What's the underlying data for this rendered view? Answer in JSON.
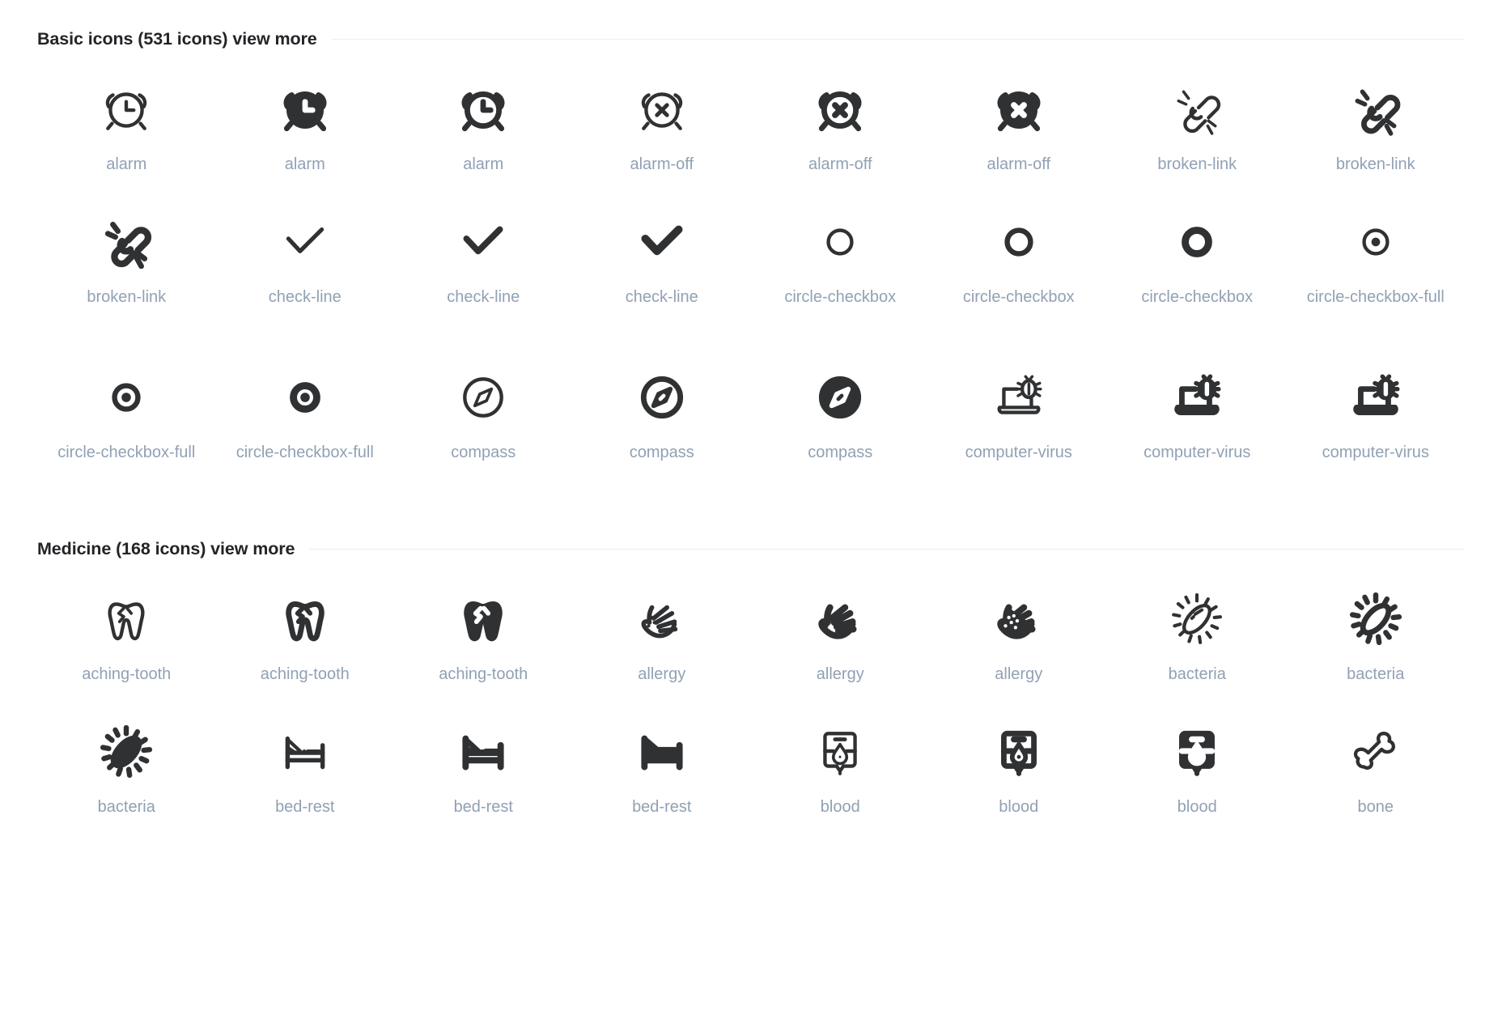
{
  "theme": {
    "background": "#ffffff",
    "icon_color": "#2f3133",
    "label_color": "#91a1b4",
    "title_color": "#222427",
    "rule_color": "#eceef1"
  },
  "sections": [
    {
      "id": "basic-icons",
      "title": "Basic icons (531 icons) view more",
      "name": "Basic icons",
      "count": "531 icons",
      "view_more": "view more",
      "icons": [
        {
          "label": "alarm",
          "glyph": "alarm",
          "style": "line"
        },
        {
          "label": "alarm",
          "glyph": "alarm",
          "style": "solid"
        },
        {
          "label": "alarm",
          "glyph": "alarm",
          "style": "bold"
        },
        {
          "label": "alarm-off",
          "glyph": "alarm-off",
          "style": "line"
        },
        {
          "label": "alarm-off",
          "glyph": "alarm-off",
          "style": "bold"
        },
        {
          "label": "alarm-off",
          "glyph": "alarm-off",
          "style": "solid"
        },
        {
          "label": "broken-link",
          "glyph": "broken-link",
          "style": "line"
        },
        {
          "label": "broken-link",
          "glyph": "broken-link",
          "style": "bold"
        },
        {
          "label": "broken-link",
          "glyph": "broken-link",
          "style": "solid"
        },
        {
          "label": "check-line",
          "glyph": "check-line",
          "style": "line"
        },
        {
          "label": "check-line",
          "glyph": "check-line",
          "style": "bold"
        },
        {
          "label": "check-line",
          "glyph": "check-line",
          "style": "solid"
        },
        {
          "label": "circle-checkbox",
          "glyph": "circle-checkbox",
          "style": "line"
        },
        {
          "label": "circle-checkbox",
          "glyph": "circle-checkbox",
          "style": "bold"
        },
        {
          "label": "circle-checkbox",
          "glyph": "circle-checkbox",
          "style": "solid"
        },
        {
          "label": "circle-checkbox-full",
          "glyph": "circle-checkbox-full",
          "style": "line"
        },
        {
          "label": "circle-checkbox-full",
          "glyph": "circle-checkbox-full",
          "style": "bold"
        },
        {
          "label": "circle-checkbox-full",
          "glyph": "circle-checkbox-full",
          "style": "solid"
        },
        {
          "label": "compass",
          "glyph": "compass",
          "style": "line"
        },
        {
          "label": "compass",
          "glyph": "compass",
          "style": "bold"
        },
        {
          "label": "compass",
          "glyph": "compass",
          "style": "solid"
        },
        {
          "label": "computer-virus",
          "glyph": "computer-virus",
          "style": "line"
        },
        {
          "label": "computer-virus",
          "glyph": "computer-virus",
          "style": "bold"
        },
        {
          "label": "computer-virus",
          "glyph": "computer-virus",
          "style": "solid"
        }
      ]
    },
    {
      "id": "medicine",
      "title": "Medicine (168 icons) view more",
      "name": "Medicine",
      "count": "168 icons",
      "view_more": "view more",
      "icons": [
        {
          "label": "aching-tooth",
          "glyph": "aching-tooth",
          "style": "line"
        },
        {
          "label": "aching-tooth",
          "glyph": "aching-tooth",
          "style": "bold"
        },
        {
          "label": "aching-tooth",
          "glyph": "aching-tooth",
          "style": "solid"
        },
        {
          "label": "allergy",
          "glyph": "allergy",
          "style": "line"
        },
        {
          "label": "allergy",
          "glyph": "allergy",
          "style": "bold"
        },
        {
          "label": "allergy",
          "glyph": "allergy",
          "style": "solid"
        },
        {
          "label": "bacteria",
          "glyph": "bacteria",
          "style": "line"
        },
        {
          "label": "bacteria",
          "glyph": "bacteria",
          "style": "bold"
        },
        {
          "label": "bacteria",
          "glyph": "bacteria",
          "style": "solid"
        },
        {
          "label": "bed-rest",
          "glyph": "bed-rest",
          "style": "line"
        },
        {
          "label": "bed-rest",
          "glyph": "bed-rest",
          "style": "bold"
        },
        {
          "label": "bed-rest",
          "glyph": "bed-rest",
          "style": "solid"
        },
        {
          "label": "blood",
          "glyph": "blood",
          "style": "line"
        },
        {
          "label": "blood",
          "glyph": "blood",
          "style": "bold"
        },
        {
          "label": "blood",
          "glyph": "blood",
          "style": "solid"
        },
        {
          "label": "bone",
          "glyph": "bone",
          "style": "line"
        }
      ]
    }
  ]
}
